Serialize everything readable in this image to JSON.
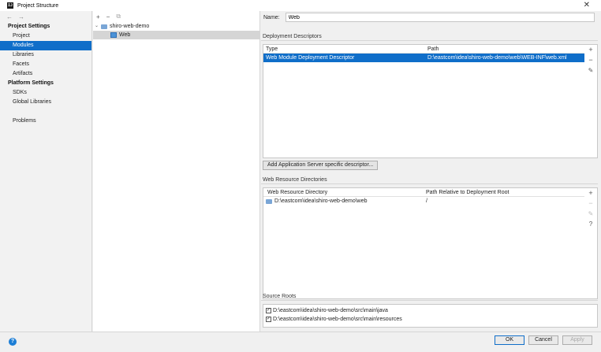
{
  "window": {
    "title": "Project Structure"
  },
  "nav": {
    "back": "←",
    "forward": "→"
  },
  "sidebar": {
    "section_project": "Project Settings",
    "project_items": [
      {
        "label": "Project"
      },
      {
        "label": "Modules"
      },
      {
        "label": "Libraries"
      },
      {
        "label": "Facets"
      },
      {
        "label": "Artifacts"
      }
    ],
    "section_platform": "Platform Settings",
    "platform_items": [
      {
        "label": "SDKs"
      },
      {
        "label": "Global Libraries"
      }
    ],
    "problems": "Problems"
  },
  "tree": {
    "toolbar": {
      "add": "+",
      "remove": "−",
      "copy": "⧉"
    },
    "root": "shiro-web-demo",
    "child": "Web"
  },
  "main": {
    "name_label": "Name:",
    "name_value": "Web",
    "deployment": {
      "label": "Deployment Descriptors",
      "columns": [
        "Type",
        "Path"
      ],
      "rows": [
        {
          "type": "Web Module Deployment Descriptor",
          "path": "D:\\eastcom\\idea\\shiro-web-demo\\web\\WEB-INF\\web.xml"
        }
      ],
      "add_server_button": "Add Application Server specific descriptor..."
    },
    "web_resources": {
      "label": "Web Resource Directories",
      "columns": [
        "Web Resource Directory",
        "Path Relative to Deployment Root"
      ],
      "rows": [
        {
          "dir": "D:\\eastcom\\idea\\shiro-web-demo\\web",
          "rel": "/"
        }
      ]
    },
    "source_roots": {
      "label": "Source Roots",
      "items": [
        {
          "label": "D:\\eastcom\\idea\\shiro-web-demo\\src\\main\\java",
          "checked": true
        },
        {
          "label": "D:\\eastcom\\idea\\shiro-web-demo\\src\\main\\resources",
          "checked": true
        }
      ]
    }
  },
  "buttons": {
    "ok": "OK",
    "cancel": "Cancel",
    "apply": "Apply"
  }
}
